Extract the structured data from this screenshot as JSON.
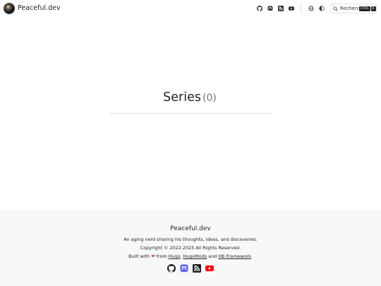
{
  "header": {
    "site_name": "Peaceful.dev",
    "search_placeholder": "Recherche",
    "kbd_ctrl": "CTRL",
    "kbd_k": "K",
    "icons": [
      "github-icon",
      "mastodon-icon",
      "rss-icon",
      "youtube-icon",
      "language-globe-icon",
      "theme-toggle-icon",
      "search-icon"
    ]
  },
  "main": {
    "title": "Series",
    "count": "(0)"
  },
  "footer": {
    "site_name": "Peaceful.dev",
    "tagline": "An aging nerd sharing his thoughts, ideas, and discoveries.",
    "copyright": "Copyright © 2022-2025 All Rights Reserved.",
    "built_prefix": "Built with",
    "built_from": "from",
    "link_hugo": "Hugo",
    "link_hugomods": "HugoMods",
    "and": "and",
    "link_hb": "HB Framework",
    "period": ".",
    "socials": [
      "github-icon",
      "mastodon-icon",
      "rss-icon",
      "youtube-icon"
    ]
  },
  "colors": {
    "heart": "#e0453b",
    "mastodon": "#6364ff",
    "youtube": "#ff0000",
    "footer_bg": "#f7f8f9"
  }
}
